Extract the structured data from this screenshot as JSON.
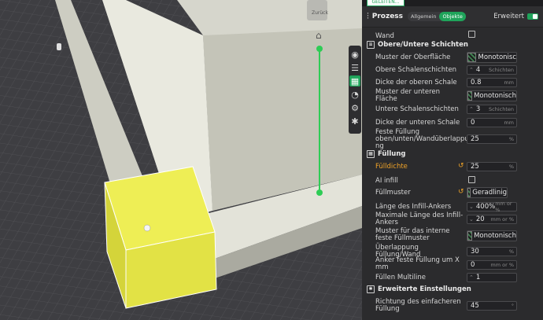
{
  "panel": {
    "top_tab": "GELEITEN...",
    "title": "Prozess",
    "seg_global": "Allgemein",
    "seg_objects": "Objekte",
    "advanced_label": "Erweitert"
  },
  "rows": {
    "wand": "Wand",
    "sec_top_bottom": "Obere/Untere Schichten",
    "top_pattern_label": "Muster der Oberfläche",
    "top_pattern_value": "Monotonisc",
    "top_shells_label": "Obere Schalenschichten",
    "top_shells_value": "4",
    "top_shells_unit": "Schichten",
    "top_thickness_label": "Dicke der oberen Schale",
    "top_thickness_value": "0.8",
    "top_thickness_unit": "mm",
    "bottom_pattern_label": "Muster der unteren Fläche",
    "bottom_pattern_value": "Monotonisch",
    "bottom_shells_label": "Untere Schalenschichten",
    "bottom_shells_value": "3",
    "bottom_shells_unit": "Schichten",
    "bottom_thickness_label": "Dicke der unteren Schale",
    "bottom_thickness_value": "0",
    "bottom_thickness_unit": "mm",
    "solid_overlap_label": "Feste Füllung oben/unten/Wandüberlappu ng",
    "solid_overlap_value": "25",
    "solid_overlap_unit": "%",
    "sec_infill": "Füllung",
    "density_label": "Fülldichte",
    "density_value": "25",
    "density_unit": "%",
    "ai_infill_label": "AI infill",
    "infill_pattern_label": "Füllmuster",
    "infill_pattern_value": "Geradlinig",
    "anchor_len_label": "Länge des Infill-Ankers",
    "anchor_len_value": "400%",
    "anchor_len_unit": "mm or %",
    "anchor_max_label": "Maximale Länge des Infill-Ankers",
    "anchor_max_value": "20",
    "anchor_max_unit": "mm or %",
    "internal_solid_label": "Muster für das interne feste Füllmuster",
    "internal_solid_value": "Monotonisch",
    "infill_wall_overlap_label": "Überlappung Füllung/Wand",
    "infill_wall_overlap_value": "30",
    "infill_wall_overlap_unit": "%",
    "solid_anchor_label": "Anker feste Füllung um X mm",
    "solid_anchor_value": "0",
    "solid_anchor_unit": "mm or %",
    "multiline_label": "Füllen Multiline",
    "multiline_value": "1",
    "sec_advanced": "Erweiterte Einstellungen",
    "sparse_dir_label": "Richtung des einfacheren Füllung",
    "sparse_dir_value": "45",
    "sparse_dir_unit": "°"
  },
  "viewport": {
    "plate_label": "Zurück"
  },
  "colors": {
    "accent": "#1fa35a",
    "highlight": "#f0a328",
    "selected_object": "#e8e84a"
  }
}
